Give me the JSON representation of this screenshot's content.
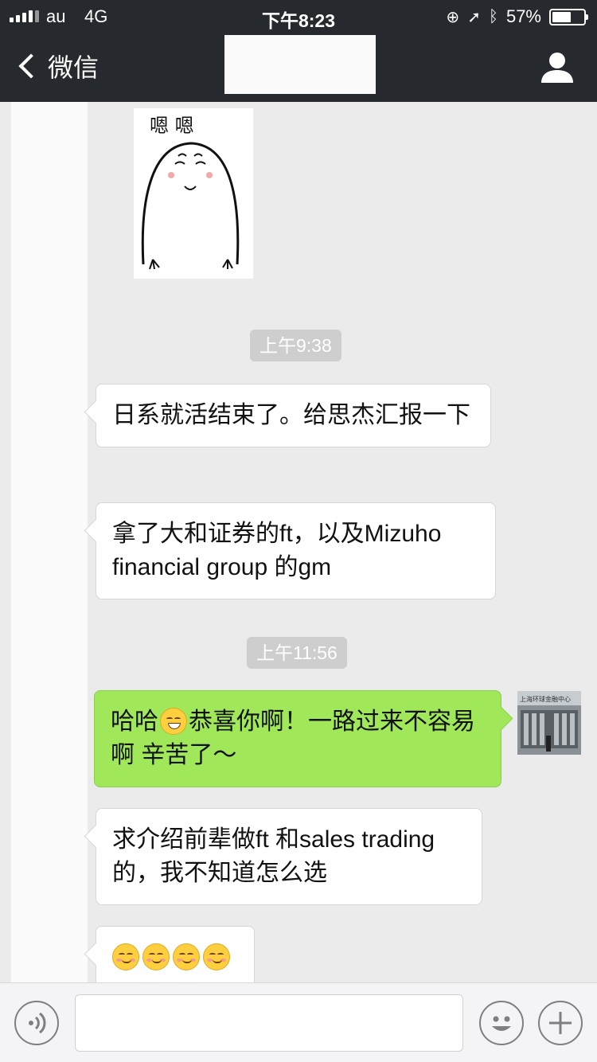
{
  "status_bar": {
    "carrier": "au",
    "network": "4G",
    "time": "下午8:23",
    "battery": "57%",
    "battery_level": 0.57
  },
  "nav": {
    "back_label": "微信"
  },
  "chat": {
    "timestamps": [
      "上午9:38",
      "上午11:56"
    ],
    "messages": [
      {
        "side": "left",
        "text": "日系就活结束了。给思杰汇报一下"
      },
      {
        "side": "left",
        "text_line1": "拿了大和证券的ft，以及Mizuho",
        "text_line2": "financial group 的gm"
      },
      {
        "side": "right",
        "text_before_emoji": "哈哈",
        "emoji": "grinning-face",
        "text_after_emoji": "恭喜你啊！一路过来不容易啊 辛苦了～"
      },
      {
        "side": "left",
        "text": "求介绍前辈做ft 和sales trading的，我不知道怎么选"
      },
      {
        "side": "left",
        "emojis": [
          "blushing-face",
          "blushing-face",
          "blushing-face",
          "blushing-face"
        ]
      }
    ],
    "sticker": {
      "caption": "嗯 嗯"
    },
    "right_avatar": {
      "caption": "上海环球金融中心"
    }
  }
}
